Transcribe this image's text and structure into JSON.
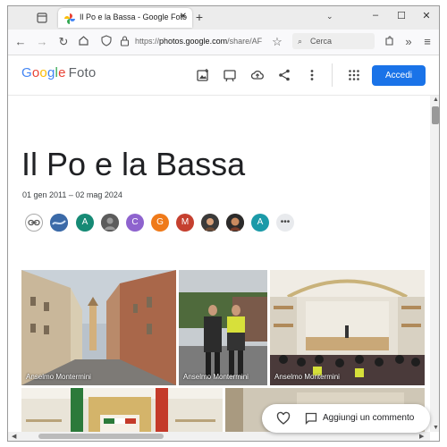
{
  "browser": {
    "tab_title": "Il Po e la Bassa - Google Foto",
    "url_prefix": "https://",
    "url_domain": "photos.google.com",
    "url_path": "/share/AF",
    "search_placeholder": "Cerca",
    "icons": [
      "tab-list-icon",
      "google-photos-favicon",
      "close-icon",
      "plus-icon",
      "chevron-down-icon",
      "minimize-icon",
      "maximize-icon",
      "window-close-icon",
      "back-arrow-icon",
      "forward-arrow-icon",
      "reload-icon",
      "home-icon",
      "shield-icon",
      "lock-icon",
      "star-icon",
      "search-icon",
      "extensions-icon",
      "overflow-icon",
      "menu-icon"
    ]
  },
  "header": {
    "logo_google": [
      "G",
      "o",
      "o",
      "g",
      "l",
      "e"
    ],
    "logo_foto": "Foto",
    "signin_label": "Accedi",
    "icons": [
      "add-photo-icon",
      "slideshow-icon",
      "cloud-upload-icon",
      "share-icon",
      "more-vert-icon",
      "apps-grid-icon"
    ]
  },
  "album": {
    "title": "Il Po e la Bassa",
    "dates": "01 gen 2011 – 02 mag 2024",
    "contributors": [
      {
        "initial": "",
        "color": "#ffffff",
        "kind": "link"
      },
      {
        "initial": "",
        "color": "#3b6aa8",
        "kind": "photo"
      },
      {
        "initial": "A",
        "color": "#168a75",
        "kind": "letter"
      },
      {
        "initial": "",
        "color": "#6d6d6d",
        "kind": "photo"
      },
      {
        "initial": "C",
        "color": "#8e63ce",
        "kind": "letter"
      },
      {
        "initial": "G",
        "color": "#ef7a1a",
        "kind": "letter"
      },
      {
        "initial": "M",
        "color": "#c5402f",
        "kind": "letter"
      },
      {
        "initial": "",
        "color": "#9a6a4a",
        "kind": "photo"
      },
      {
        "initial": "",
        "color": "#7a4a2a",
        "kind": "photo"
      },
      {
        "initial": "A",
        "color": "#1b9aa8",
        "kind": "letter"
      },
      {
        "initial": "•••",
        "color": "#e8eaed",
        "kind": "more"
      }
    ],
    "photos": [
      {
        "caption": "Anselmo Montermini"
      },
      {
        "caption": "Anselmo Montermini"
      },
      {
        "caption": "Anselmo Montermini"
      }
    ]
  },
  "comment_bar": {
    "label": "Aggiungi un commento",
    "icons": [
      "heart-icon",
      "comment-icon"
    ]
  },
  "colors": {
    "accent": "#1a73e8"
  }
}
